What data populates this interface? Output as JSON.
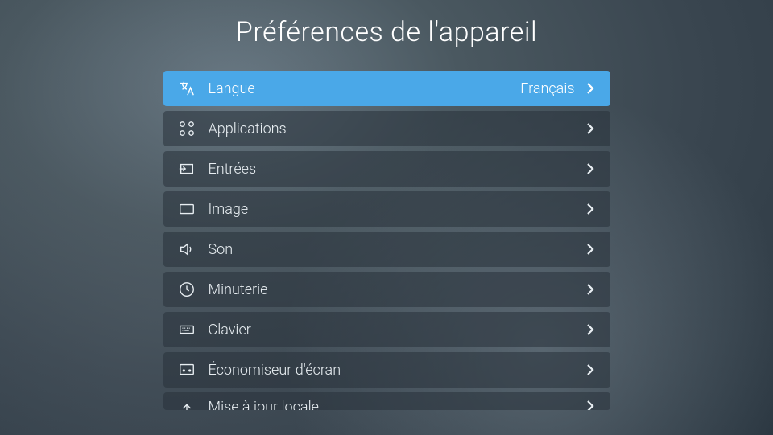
{
  "title": "Préférences de l'appareil",
  "menu": {
    "items": [
      {
        "label": "Langue",
        "value": "Français",
        "icon": "translate-icon",
        "selected": true
      },
      {
        "label": "Applications",
        "value": "",
        "icon": "apps-icon",
        "selected": false
      },
      {
        "label": "Entrées",
        "value": "",
        "icon": "input-icon",
        "selected": false
      },
      {
        "label": "Image",
        "value": "",
        "icon": "display-icon",
        "selected": false
      },
      {
        "label": "Son",
        "value": "",
        "icon": "sound-icon",
        "selected": false
      },
      {
        "label": "Minuterie",
        "value": "",
        "icon": "timer-icon",
        "selected": false
      },
      {
        "label": "Clavier",
        "value": "",
        "icon": "keyboard-icon",
        "selected": false
      },
      {
        "label": "Économiseur d'écran",
        "value": "",
        "icon": "screensaver-icon",
        "selected": false
      },
      {
        "label": "Mise à jour locale",
        "value": "",
        "icon": "update-icon",
        "selected": false
      }
    ]
  },
  "colors": {
    "selected_bg": "#4aa8e8",
    "item_bg": "rgba(40,50,58,0.55)",
    "text": "#e8eef2"
  }
}
